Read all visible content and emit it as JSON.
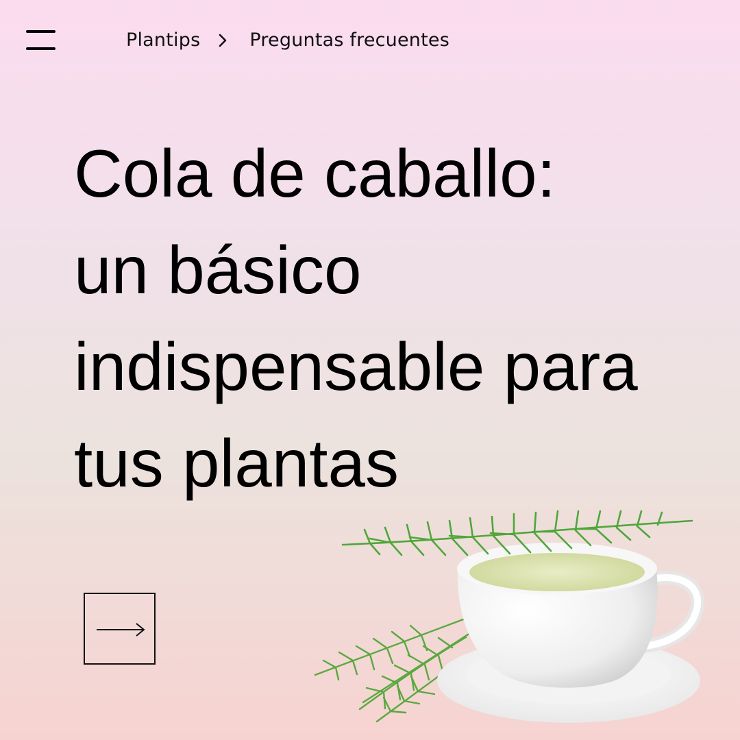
{
  "header": {
    "menu_icon": "hamburger-menu-icon",
    "breadcrumb": {
      "items": [
        "Plantips",
        "Preguntas frecuentes"
      ],
      "separator_icon": "chevron-right-icon"
    }
  },
  "hero": {
    "title_lines": [
      "Cola de caballo:",
      "un básico",
      "indispensable para",
      "tus plantas"
    ]
  },
  "navigation": {
    "next_icon": "arrow-right-icon"
  },
  "image": {
    "subject": "horsetail-tea-cup-icon"
  },
  "colors": {
    "background_top": "#fbdcef",
    "background_bottom": "#f6d3d1",
    "text": "#000000",
    "plant_green": "#4fa63a",
    "tea": "#dfe6b8"
  }
}
